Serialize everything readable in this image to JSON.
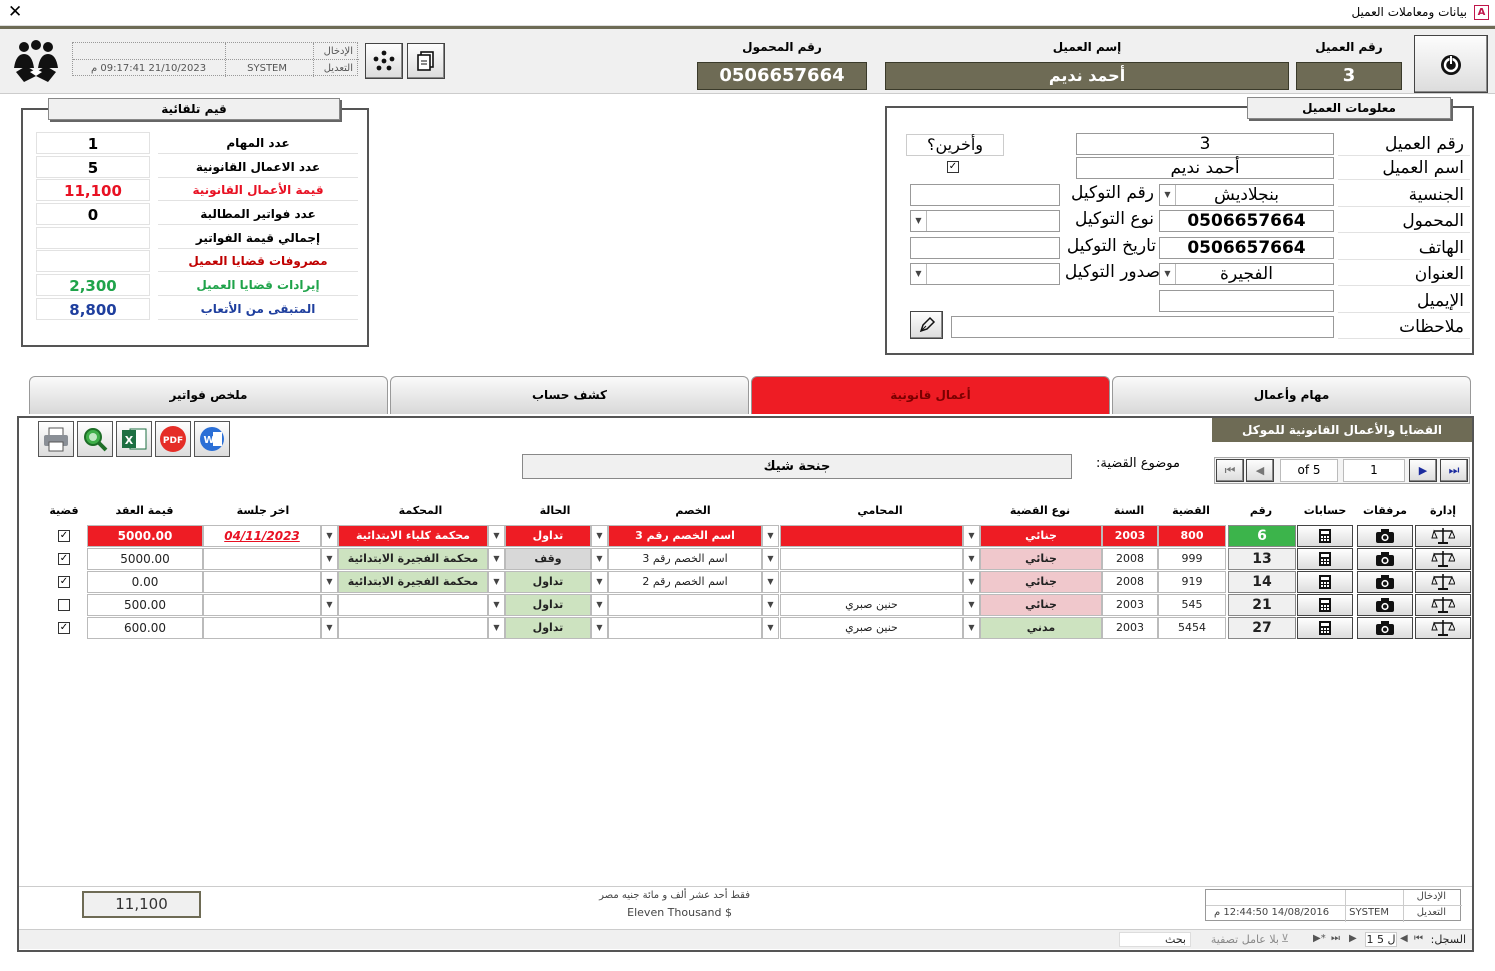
{
  "window": {
    "title": "بيانات ومعاملات العميل",
    "app_icon": "A"
  },
  "header": {
    "client_no_label": "رقم العميل",
    "client_no": "3",
    "client_name_label": "إسم العميل",
    "client_name": "أحمد نديم",
    "mobile_label": "رقم المحمول",
    "mobile": "0506657664",
    "audit": {
      "entry_label": "الإدخال",
      "edit_label": "التعديل",
      "user": "SYSTEM",
      "datetime": "21/10/2023 09:17:41 م"
    }
  },
  "auto_values": {
    "title": "قيم تلقائية",
    "rows": [
      {
        "label": "عدد المهام",
        "value": "1",
        "color": "#000000"
      },
      {
        "label": "عدد الاعمال القانونية",
        "value": "5",
        "color": "#000000"
      },
      {
        "label": "قيمة الأعمال القانونية",
        "value": "11,100",
        "color": "#e81123"
      },
      {
        "label": "عدد فواتير المطالبة",
        "value": "0",
        "color": "#000000"
      },
      {
        "label": "إجمالي قيمة الفواتير",
        "value": "",
        "color": "#000000"
      },
      {
        "label": "مصروفات قضايا العميل",
        "value": "",
        "color": "#c00000"
      },
      {
        "label": "إيرادات قضايا العميل",
        "value": "2,300",
        "color": "#1fa34a"
      },
      {
        "label": "المتبقى من الأتعاب",
        "value": "8,800",
        "color": "#1f3f9e"
      }
    ]
  },
  "client_info": {
    "title": "معلومات العميل",
    "labels": {
      "client_no": "رقم العميل",
      "client_name": "اسم العميل",
      "nationality": "الجنسية",
      "mobile": "المحمول",
      "phone": "الهاتف",
      "address": "العنوان",
      "email": "الإيميل",
      "notes": "ملاحظات",
      "poa_no": "رقم التوكيل",
      "poa_type": "نوع التوكيل",
      "poa_date": "تاريخ التوكيل",
      "poa_issue": "صدور التوكيل",
      "others": "وأخرين؟"
    },
    "values": {
      "client_no": "3",
      "client_name": "أحمد نديم",
      "nationality": "بنجلاديش",
      "mobile": "0506657664",
      "phone": "0506657664",
      "address": "الفجيرة",
      "email": "",
      "notes": "",
      "poa_no": "",
      "poa_type": "",
      "poa_date": "",
      "poa_issue": "",
      "others_checked": true
    }
  },
  "tabs": [
    {
      "label": "مهام وأعمال",
      "active": false
    },
    {
      "label": "أعمال قانونية",
      "active": true
    },
    {
      "label": "كشف حساب",
      "active": false
    },
    {
      "label": "ملخص فواتير",
      "active": false
    }
  ],
  "cases": {
    "section_title": "القضايا والأعمال القانونية للموكل",
    "subject_label": "موضوع القضية:",
    "subject": "جنحة شيك",
    "nav": {
      "current": "1",
      "of": "of 5"
    },
    "columns": {
      "manage": "إدارة",
      "attachments": "مرفقات",
      "accounts": "حسابات",
      "no": "رقم",
      "case": "القضية",
      "year": "السنة",
      "type": "نوع القضية",
      "lawyer": "المحامي",
      "opponent": "الخصم",
      "status": "الحالة",
      "court": "المحكمة",
      "last_session": "اخر جلسة",
      "contract_value": "قيمة العقد",
      "case_flag": "قضية"
    },
    "rows": [
      {
        "no": "6",
        "case": "800",
        "year": "2003",
        "type": "جنائي",
        "lawyer": "",
        "opponent": "اسم الخصم رقم 3",
        "status": "تداول",
        "court": "محكمة كلباء الابتدائية",
        "last_session": "04/11/2023",
        "contract_value": "5000.00",
        "flag": true,
        "selected": true
      },
      {
        "no": "13",
        "case": "999",
        "year": "2008",
        "type": "جنائي",
        "lawyer": "",
        "opponent": "اسم الخصم رقم 3",
        "status": "وقف",
        "court": "محكمة الفجيرة الابتدائية",
        "last_session": "",
        "contract_value": "5000.00",
        "flag": true,
        "selected": false
      },
      {
        "no": "14",
        "case": "919",
        "year": "2008",
        "type": "جنائي",
        "lawyer": "",
        "opponent": "اسم الخصم رقم 2",
        "status": "تداول",
        "court": "محكمة الفجيرة الابتدائية",
        "last_session": "",
        "contract_value": "0.00",
        "flag": true,
        "selected": false
      },
      {
        "no": "21",
        "case": "545",
        "year": "2003",
        "type": "جنائي",
        "lawyer": "حنين صبري",
        "opponent": "",
        "status": "تداول",
        "court": "",
        "last_session": "",
        "contract_value": "500.00",
        "flag": false,
        "selected": false
      },
      {
        "no": "27",
        "case": "5454",
        "year": "2003",
        "type": "مدني",
        "lawyer": "حنين صبري",
        "opponent": "",
        "status": "تداول",
        "court": "",
        "last_session": "",
        "contract_value": "600.00",
        "flag": true,
        "selected": false
      }
    ],
    "total": "11,100",
    "total_words_ar": "فقط أحد عشر ألف و مائة جنيه مصر",
    "total_words_en": "Eleven Thousand $",
    "audit": {
      "entry_label": "الإدخال",
      "edit_label": "التعديل",
      "user": "SYSTEM",
      "datetime": "14/08/2016 12:44:50 م"
    }
  },
  "statusbar": {
    "record_label": "السجل:",
    "record": "1 ل 5",
    "filter": "بلا عامل تصفية",
    "search": "بحث"
  },
  "toolbar": {
    "pdf": "PDF",
    "word": "W"
  }
}
